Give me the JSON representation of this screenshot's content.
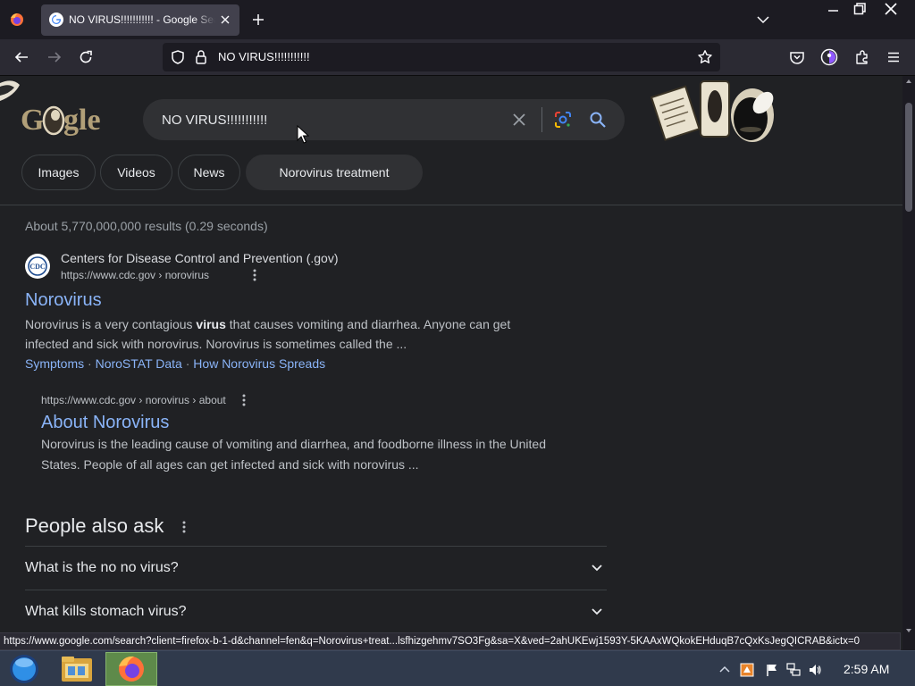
{
  "browser": {
    "tab": {
      "title": "NO VIRUS!!!!!!!!!!! - Google Search"
    },
    "url": "NO VIRUS!!!!!!!!!!!",
    "status_link": "https://www.google.com/search?client=firefox-b-1-d&channel=fen&q=Norovirus+treat...lsfhizgehmv7SO3Fg&sa=X&ved=2ahUKEwj1593Y-5KAAxWQkokEHduqB7cQxKsJegQICRAB&ictx=0"
  },
  "search": {
    "query": "NO VIRUS!!!!!!!!!!!",
    "chips": [
      "Images",
      "Videos",
      "News",
      "Norovirus treatment"
    ],
    "result_stats": "About 5,770,000,000 results (0.29 seconds)"
  },
  "results": [
    {
      "site_name": "Centers for Disease Control and Prevention (.gov)",
      "favicon_text": "CDC",
      "url": "https://www.cdc.gov › norovirus",
      "title": "Norovirus",
      "snippet_l1_a": "Norovirus is a very contagious ",
      "snippet_l1_bold": "virus",
      "snippet_l1_b": " that causes vomiting and diarrhea. Anyone can get",
      "snippet_l2": "infected and sick with norovirus. Norovirus is sometimes called the ...",
      "sitelinks": [
        "Symptoms",
        "NoroSTAT Data",
        "How Norovirus Spreads"
      ],
      "sitelink_sep": " · "
    },
    {
      "url": "https://www.cdc.gov › norovirus › about",
      "title": "About Norovirus",
      "snippet_l1": "Norovirus is the leading cause of vomiting and diarrhea, and foodborne illness in the United",
      "snippet_l2": "States. People of all ages can get infected and sick with norovirus ..."
    }
  ],
  "people_also_ask": {
    "title": "People also ask",
    "questions": [
      "What is the no no virus?",
      "What kills stomach virus?"
    ]
  },
  "taskbar": {
    "clock": "2:59 AM"
  },
  "colors": {
    "page_bg": "#202124",
    "link": "#8ab4f8",
    "browser_chrome": "#2b2a33",
    "taskbar": "#303a4c"
  }
}
